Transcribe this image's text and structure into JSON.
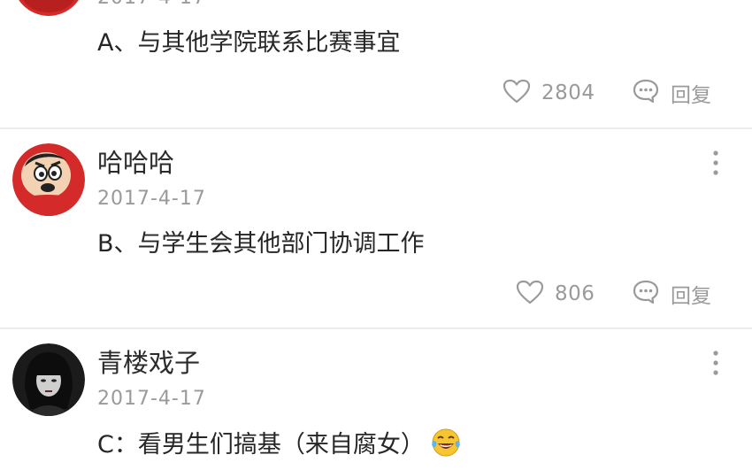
{
  "comments": [
    {
      "username": "",
      "timestamp": "2017-4-17",
      "content": "A、与其他学院联系比赛事宜",
      "likes": "2804",
      "reply_label": "回复"
    },
    {
      "username": "哈哈哈",
      "timestamp": "2017-4-17",
      "content": "B、与学生会其他部门协调工作",
      "likes": "806",
      "reply_label": "回复"
    },
    {
      "username": "青楼戏子",
      "timestamp": "2017-4-17",
      "content": "C：看男生们搞基（来自腐女）",
      "emoji": "laughing-tears-emoji"
    }
  ],
  "colors": {
    "text_primary": "#262626",
    "text_secondary": "#9a9a9a",
    "divider": "#ececec",
    "avatar_red": "#d42a2a"
  },
  "icons": {
    "like": "heart-outline-icon",
    "reply": "speech-bubble-icon",
    "more": "vertical-dots-icon"
  }
}
